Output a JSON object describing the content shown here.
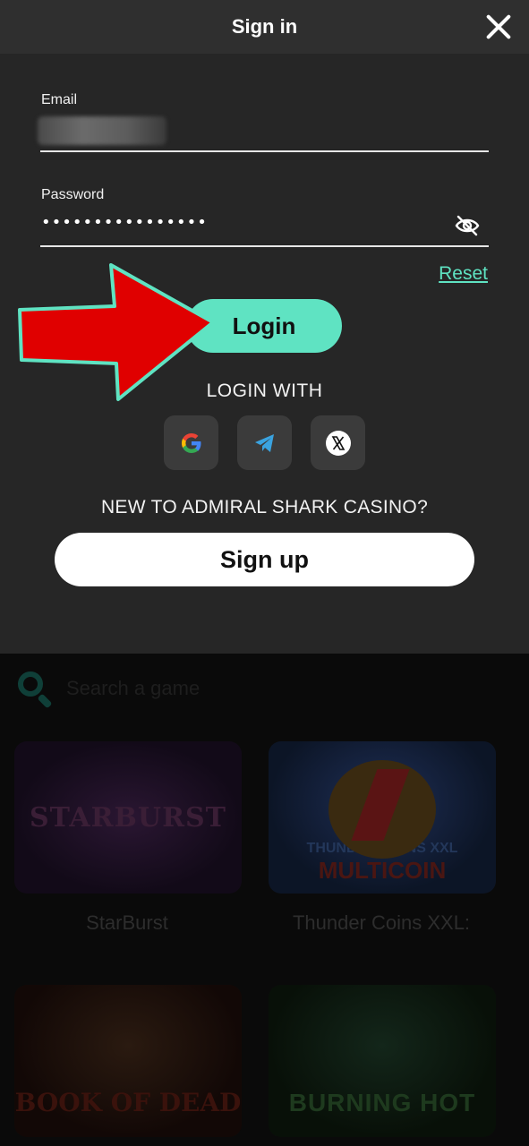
{
  "modal": {
    "title": "Sign in",
    "email_label": "Email",
    "password_label": "Password",
    "password_value": "••••••••••••••••",
    "reset_label": "Reset",
    "login_label": "Login",
    "login_with_label": "LOGIN WITH",
    "social": [
      "google-icon",
      "telegram-icon",
      "x-icon"
    ],
    "new_to_label": "NEW TO ADMIRAL SHARK CASINO?",
    "signup_label": "Sign up"
  },
  "background": {
    "search_placeholder": "Search a game",
    "games": [
      {
        "name": "StarBurst",
        "art_text": "STARBURST"
      },
      {
        "name": "Thunder Coins XXL:",
        "art_text_1": "THUNDER COINS XXL",
        "art_text_2": "MULTICOIN"
      },
      {
        "name": "",
        "art_text": "BOOK OF DEAD"
      },
      {
        "name": "",
        "art_text": "BURNING HOT"
      }
    ]
  },
  "colors": {
    "accent": "#5fe3c2",
    "modal_bg": "#262626",
    "header_bg": "#2f2f2f",
    "arrow_red": "#e00000"
  }
}
